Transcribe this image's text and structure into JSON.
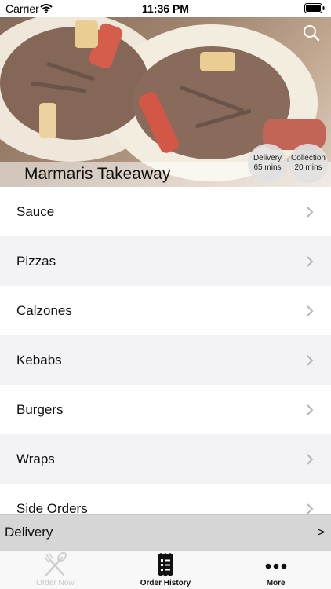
{
  "status_bar": {
    "carrier": "Carrier",
    "time": "11:36 PM"
  },
  "header": {
    "restaurant_name": "Marmaris Takeaway",
    "delivery_badge": {
      "label": "Delivery",
      "time": "65 mins"
    },
    "collection_badge": {
      "label": "Collection",
      "time": "20 mins"
    },
    "search_icon": "search-icon"
  },
  "menu": {
    "categories": [
      "Sauce",
      "Pizzas",
      "Calzones",
      "Kebabs",
      "Burgers",
      "Wraps",
      "Side Orders"
    ]
  },
  "order_mode": {
    "label": "Delivery",
    "arrow": ">"
  },
  "tab_bar": {
    "tabs": [
      {
        "label": "Order Now",
        "icon": "fork-knife-icon",
        "state": "disabled"
      },
      {
        "label": "Order History",
        "icon": "receipt-icon",
        "state": "active"
      },
      {
        "label": "More",
        "icon": "more-dots-icon",
        "state": "normal"
      }
    ]
  },
  "colors": {
    "row_alt": "#f3f3f5",
    "delivery_bar": "#d6d6d6",
    "tab_inactive": "#c8c8c8"
  }
}
